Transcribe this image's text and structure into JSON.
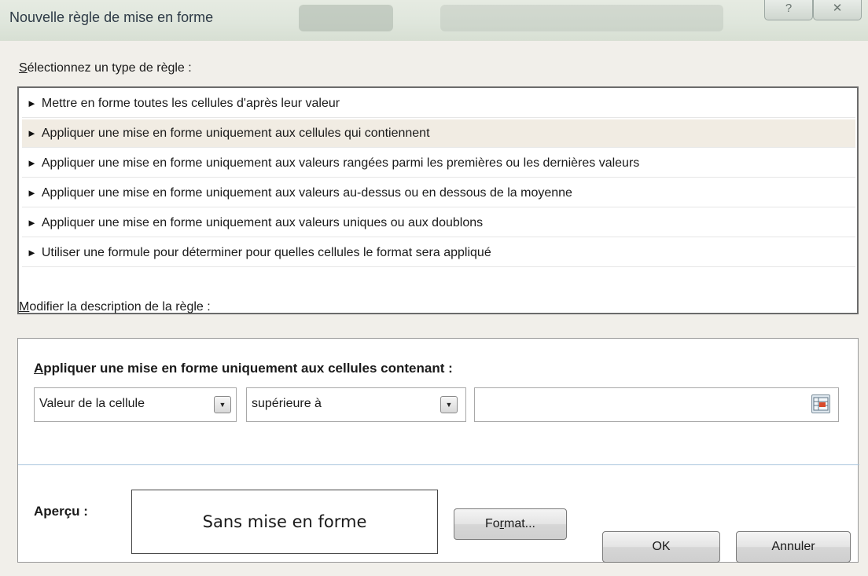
{
  "window": {
    "title": "Nouvelle règle de mise en forme",
    "help_glyph": "?",
    "close_glyph": "✕"
  },
  "rule_type": {
    "label": "électionnez un type de règle :",
    "label_underlined": "S",
    "items": [
      {
        "label": "Mettre en forme toutes les cellules d'après leur valeur",
        "selected": false
      },
      {
        "label": "Appliquer une mise en forme uniquement aux cellules qui contiennent",
        "selected": true
      },
      {
        "label": "Appliquer une mise en forme uniquement aux valeurs rangées parmi les premières ou les dernières valeurs",
        "selected": false
      },
      {
        "label": "Appliquer une mise en forme uniquement aux valeurs au-dessus ou en dessous de la moyenne",
        "selected": false
      },
      {
        "label": "Appliquer une mise en forme uniquement aux valeurs uniques ou aux doublons",
        "selected": false
      },
      {
        "label": "Utiliser une formule pour déterminer pour quelles cellules le format sera appliqué",
        "selected": false
      }
    ],
    "arrow_glyph": "►"
  },
  "description": {
    "label_underlined": "M",
    "label": "odifier la description de la règle :",
    "title_underlined": "A",
    "title": "ppliquer une mise en forme uniquement aux cellules contenant :",
    "combo1_value": "Valeur de la cellule",
    "combo2_value": "supérieure à",
    "value_input": "",
    "dropdown_glyph": "▼"
  },
  "preview": {
    "label": "Aperçu :",
    "text": "Sans mise en forme",
    "format_button_pre": "Fo",
    "format_button_underlined": "r",
    "format_button_post": "mat..."
  },
  "footer": {
    "ok_label": "OK",
    "cancel_label": "Annuler"
  },
  "colors": {
    "selected_row": "#f1ece3",
    "separator": "#a9c5dd",
    "dialog_bg": "#f1efea"
  }
}
